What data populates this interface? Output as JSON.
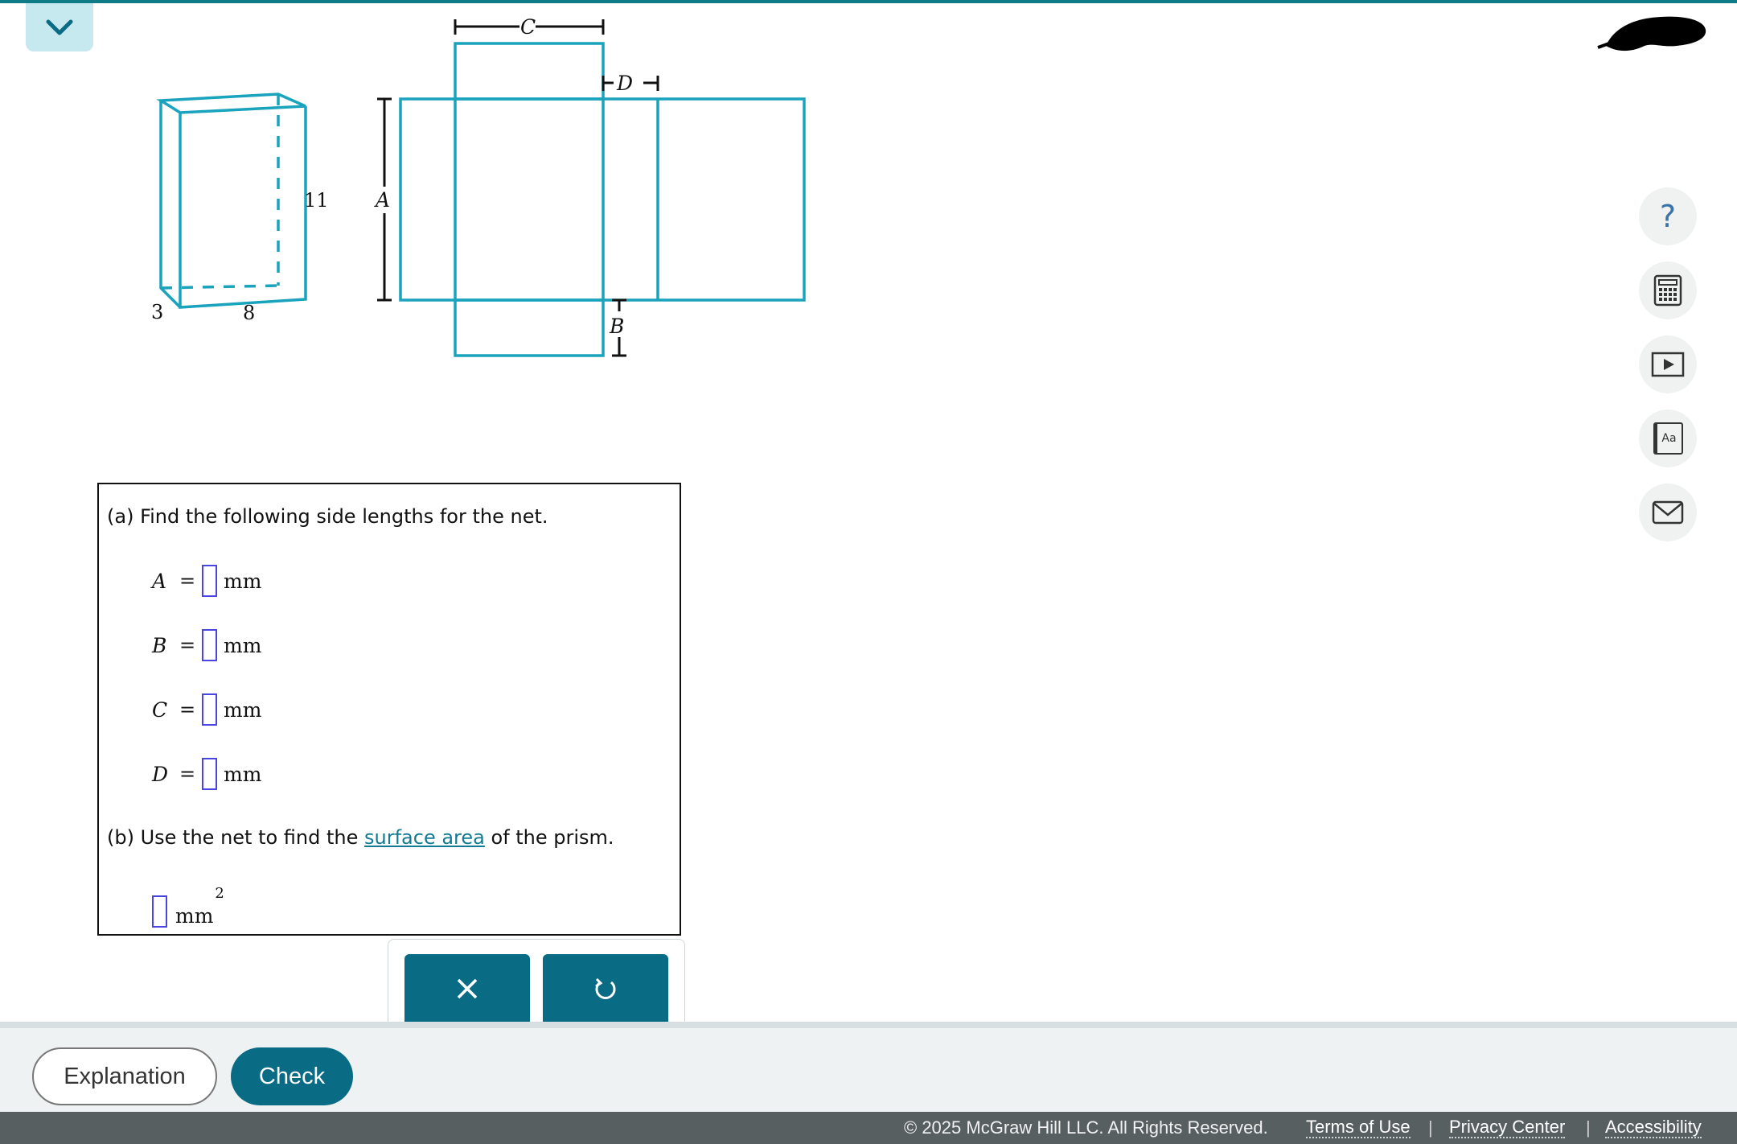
{
  "colors": {
    "accent": "#0e7c86",
    "figure_stroke": "#1aa3bd",
    "answer_box": "#4a45e0",
    "button": "#0a6b84"
  },
  "header": {
    "collapse_icon": "chevron-down-icon",
    "avatar": "redacted-avatar"
  },
  "tools": [
    {
      "name": "help",
      "icon": "question-icon",
      "glyph": "?"
    },
    {
      "name": "calculator",
      "icon": "calculator-icon"
    },
    {
      "name": "video",
      "icon": "video-play-icon"
    },
    {
      "name": "glossary",
      "icon": "glossary-book-icon",
      "glyph": "Aa"
    },
    {
      "name": "message",
      "icon": "mail-icon"
    }
  ],
  "figure": {
    "prism_labels": {
      "height": "11",
      "depth": "3",
      "width": "8"
    },
    "net_labels": {
      "a": "A",
      "b": "B",
      "c": "C",
      "d": "D"
    }
  },
  "question": {
    "part_a": "(a) Find the following side lengths for the net.",
    "rows": [
      {
        "var": "A",
        "eq": "=",
        "value": "",
        "unit": "mm"
      },
      {
        "var": "B",
        "eq": "=",
        "value": "",
        "unit": "mm"
      },
      {
        "var": "C",
        "eq": "=",
        "value": "",
        "unit": "mm"
      },
      {
        "var": "D",
        "eq": "=",
        "value": "",
        "unit": "mm"
      }
    ],
    "part_b_before": "(b) Use the net to find the ",
    "part_b_link": "surface area",
    "part_b_after": " of the prism.",
    "sa_value": "",
    "sa_unit": "mm",
    "sa_exponent": "2"
  },
  "keypad": {
    "clear_icon": "close-icon",
    "undo_icon": "undo-icon"
  },
  "actions": {
    "explanation": "Explanation",
    "check": "Check"
  },
  "footer": {
    "copyright": "© 2025 McGraw Hill LLC. All Rights Reserved.",
    "links": [
      "Terms of Use",
      "Privacy Center",
      "Accessibility"
    ],
    "separator": "|"
  }
}
